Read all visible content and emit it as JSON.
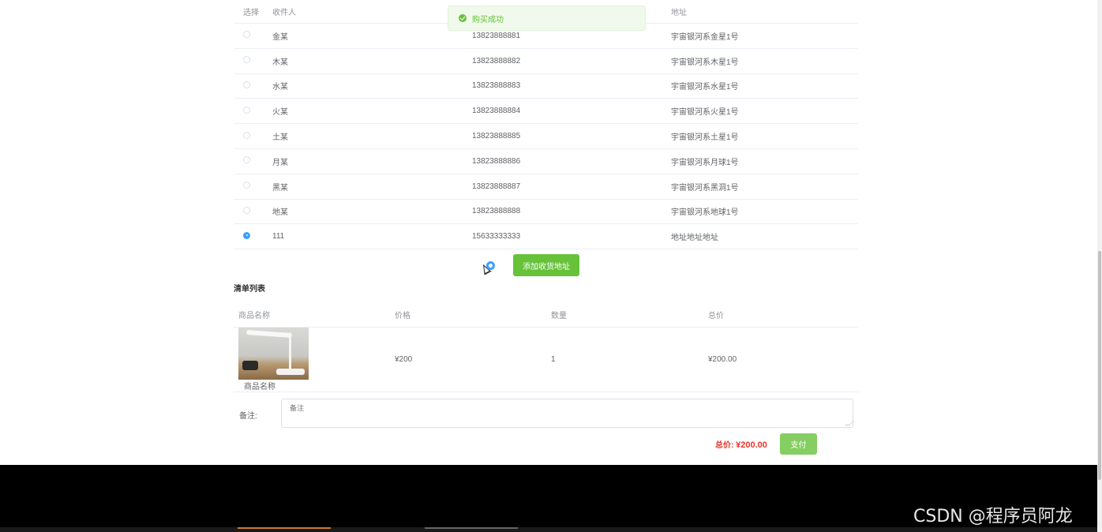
{
  "address_table": {
    "headers": [
      "选择",
      "收件人",
      "地址"
    ],
    "rows": [
      {
        "name": "金某",
        "phone": "13823888881",
        "address": "宇宙银河系金星1号",
        "selected": false
      },
      {
        "name": "木某",
        "phone": "13823888882",
        "address": "宇宙银河系木星1号",
        "selected": false
      },
      {
        "name": "水某",
        "phone": "13823888883",
        "address": "宇宙银河系水星1号",
        "selected": false
      },
      {
        "name": "火某",
        "phone": "13823888884",
        "address": "宇宙银河系火星1号",
        "selected": false
      },
      {
        "name": "土某",
        "phone": "13823888885",
        "address": "宇宙银河系土星1号",
        "selected": false
      },
      {
        "name": "月某",
        "phone": "13823888886",
        "address": "宇宙银河系月球1号",
        "selected": false
      },
      {
        "name": "黑某",
        "phone": "13823888887",
        "address": "宇宙银河系黑洞1号",
        "selected": false
      },
      {
        "name": "地某",
        "phone": "13823888888",
        "address": "宇宙银河系地球1号",
        "selected": false
      },
      {
        "name": "111",
        "phone": "15633333333",
        "address": "地址地址地址",
        "selected": true
      }
    ]
  },
  "toast": {
    "message": "购买成功",
    "icon": "success-check-icon",
    "color": "#67c23a"
  },
  "add_address_button": "添加收货地址",
  "list": {
    "title": "清单列表",
    "headers": [
      "商品名称",
      "价格",
      "数量",
      "总价"
    ],
    "items": [
      {
        "name": "商品名称",
        "price": "¥200",
        "quantity": "1",
        "total": "¥200.00"
      }
    ]
  },
  "remark": {
    "label": "备注:",
    "placeholder": "备注"
  },
  "summary": {
    "label": "总价:",
    "amount": "¥200.00"
  },
  "pay_button": "支付",
  "watermark": "CSDN @程序员阿龙",
  "colors": {
    "primary_green": "#67c23a",
    "price_red": "#e5352b",
    "radio_blue": "#409eff"
  }
}
